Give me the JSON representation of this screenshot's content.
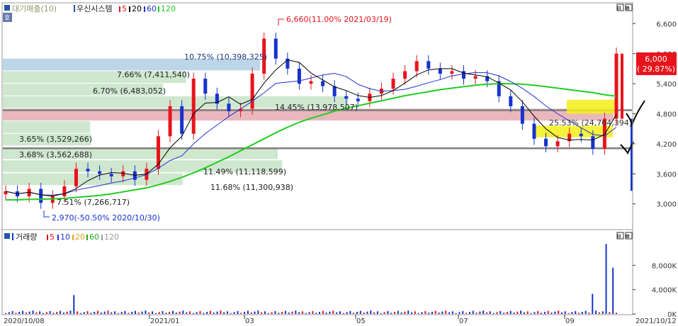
{
  "price_panel": {
    "legend": {
      "label": "대기매출(10)",
      "symbol_label": "우신시스템",
      "ma": [
        "5",
        "20",
        "60",
        "120"
      ]
    },
    "annotations": {
      "high": "6,660(11.00% 2021/03/19)",
      "low": "2,970(-50.50% 2020/10/30)",
      "current_price": "6,000",
      "current_change": "( 29.87%)"
    },
    "volume_profile_labels": [
      "10.75% (10,398,325)",
      "7.66% (7,411,540)",
      "6.70% (6,483,052)",
      "14.45% (13,978,507)",
      "25.53% (24,704,394)",
      "3.65% (3,529,266)",
      "3.68% (3,562,688)",
      "11.49% (11,118,599)",
      "11.68% (11,300,938)",
      "7.51% (7,266,717)"
    ]
  },
  "volume_panel": {
    "legend": {
      "label": "거래량",
      "ma": [
        "5",
        "10",
        "20",
        "60",
        "120"
      ]
    }
  },
  "x_axis": {
    "labels": [
      "2020/10/08",
      "2021/01",
      "03",
      "05",
      "07",
      "09",
      "2021/10/12"
    ]
  },
  "window_buttons": [
    "⊟",
    "⊠"
  ],
  "colors": {
    "up": "#e8141c",
    "down": "#1533cc",
    "ma5": "#e8141c",
    "ma20": "#000000",
    "ma60": "#2233cc",
    "ma120": "#22cc22"
  },
  "chart_data": {
    "type": "candlestick",
    "x": [
      "2020/10/08",
      "2020/10/15",
      "2020/10/22",
      "2020/10/30",
      "2020/11/05",
      "2020/11/12",
      "2020/11/19",
      "2020/11/26",
      "2020/12/03",
      "2020/12/10",
      "2020/12/17",
      "2020/12/24",
      "2021/01/04",
      "2021/01/11",
      "2021/01/18",
      "2021/01/25",
      "2021/02/01",
      "2021/02/08",
      "2021/02/15",
      "2021/02/22",
      "2021/03/02",
      "2021/03/09",
      "2021/03/19",
      "2021/03/26",
      "2021/04/02",
      "2021/04/09",
      "2021/04/16",
      "2021/04/23",
      "2021/04/30",
      "2021/05/07",
      "2021/05/14",
      "2021/05/21",
      "2021/05/28",
      "2021/06/04",
      "2021/06/11",
      "2021/06/18",
      "2021/06/25",
      "2021/07/02",
      "2021/07/09",
      "2021/07/16",
      "2021/07/23",
      "2021/07/30",
      "2021/08/06",
      "2021/08/13",
      "2021/08/20",
      "2021/08/27",
      "2021/09/03",
      "2021/09/10",
      "2021/09/17",
      "2021/09/24",
      "2021/10/01",
      "2021/10/08",
      "2021/10/12"
    ],
    "close": [
      3250,
      3150,
      3300,
      3020,
      3150,
      3350,
      3700,
      3650,
      3600,
      3550,
      3650,
      3480,
      3700,
      4350,
      4950,
      4400,
      5500,
      5200,
      5000,
      4850,
      4900,
      5600,
      6300,
      5900,
      5700,
      5400,
      5450,
      5350,
      5150,
      5100,
      5050,
      5200,
      5300,
      5500,
      5650,
      5850,
      5700,
      5600,
      5650,
      5500,
      5550,
      5450,
      5150,
      4950,
      4600,
      4300,
      4150,
      4250,
      4400,
      4350,
      4100,
      4700,
      6000
    ],
    "ma120": [
      3080,
      3080,
      3090,
      3090,
      3100,
      3110,
      3130,
      3150,
      3170,
      3200,
      3240,
      3280,
      3320,
      3380,
      3450,
      3530,
      3620,
      3720,
      3830,
      3940,
      4060,
      4180,
      4300,
      4420,
      4530,
      4630,
      4710,
      4780,
      4850,
      4910,
      4960,
      5010,
      5060,
      5110,
      5160,
      5200,
      5240,
      5280,
      5310,
      5340,
      5370,
      5390,
      5400,
      5400,
      5390,
      5370,
      5340,
      5310,
      5280,
      5250,
      5220,
      5180,
      5150
    ],
    "volume_profile_pct": [
      10.75,
      7.66,
      6.7,
      14.45,
      25.53,
      3.65,
      3.68,
      11.49,
      11.68,
      7.51
    ],
    "y_ticks": [
      "6,600",
      "6,000",
      "5,400",
      "4,800",
      "4,200",
      "3,600",
      "3,000"
    ],
    "ylim": [
      2500,
      7000
    ],
    "volume_ticks": [
      "8,000K",
      "4,000K",
      "0K"
    ],
    "volume_ylim": [
      0,
      12000
    ]
  }
}
